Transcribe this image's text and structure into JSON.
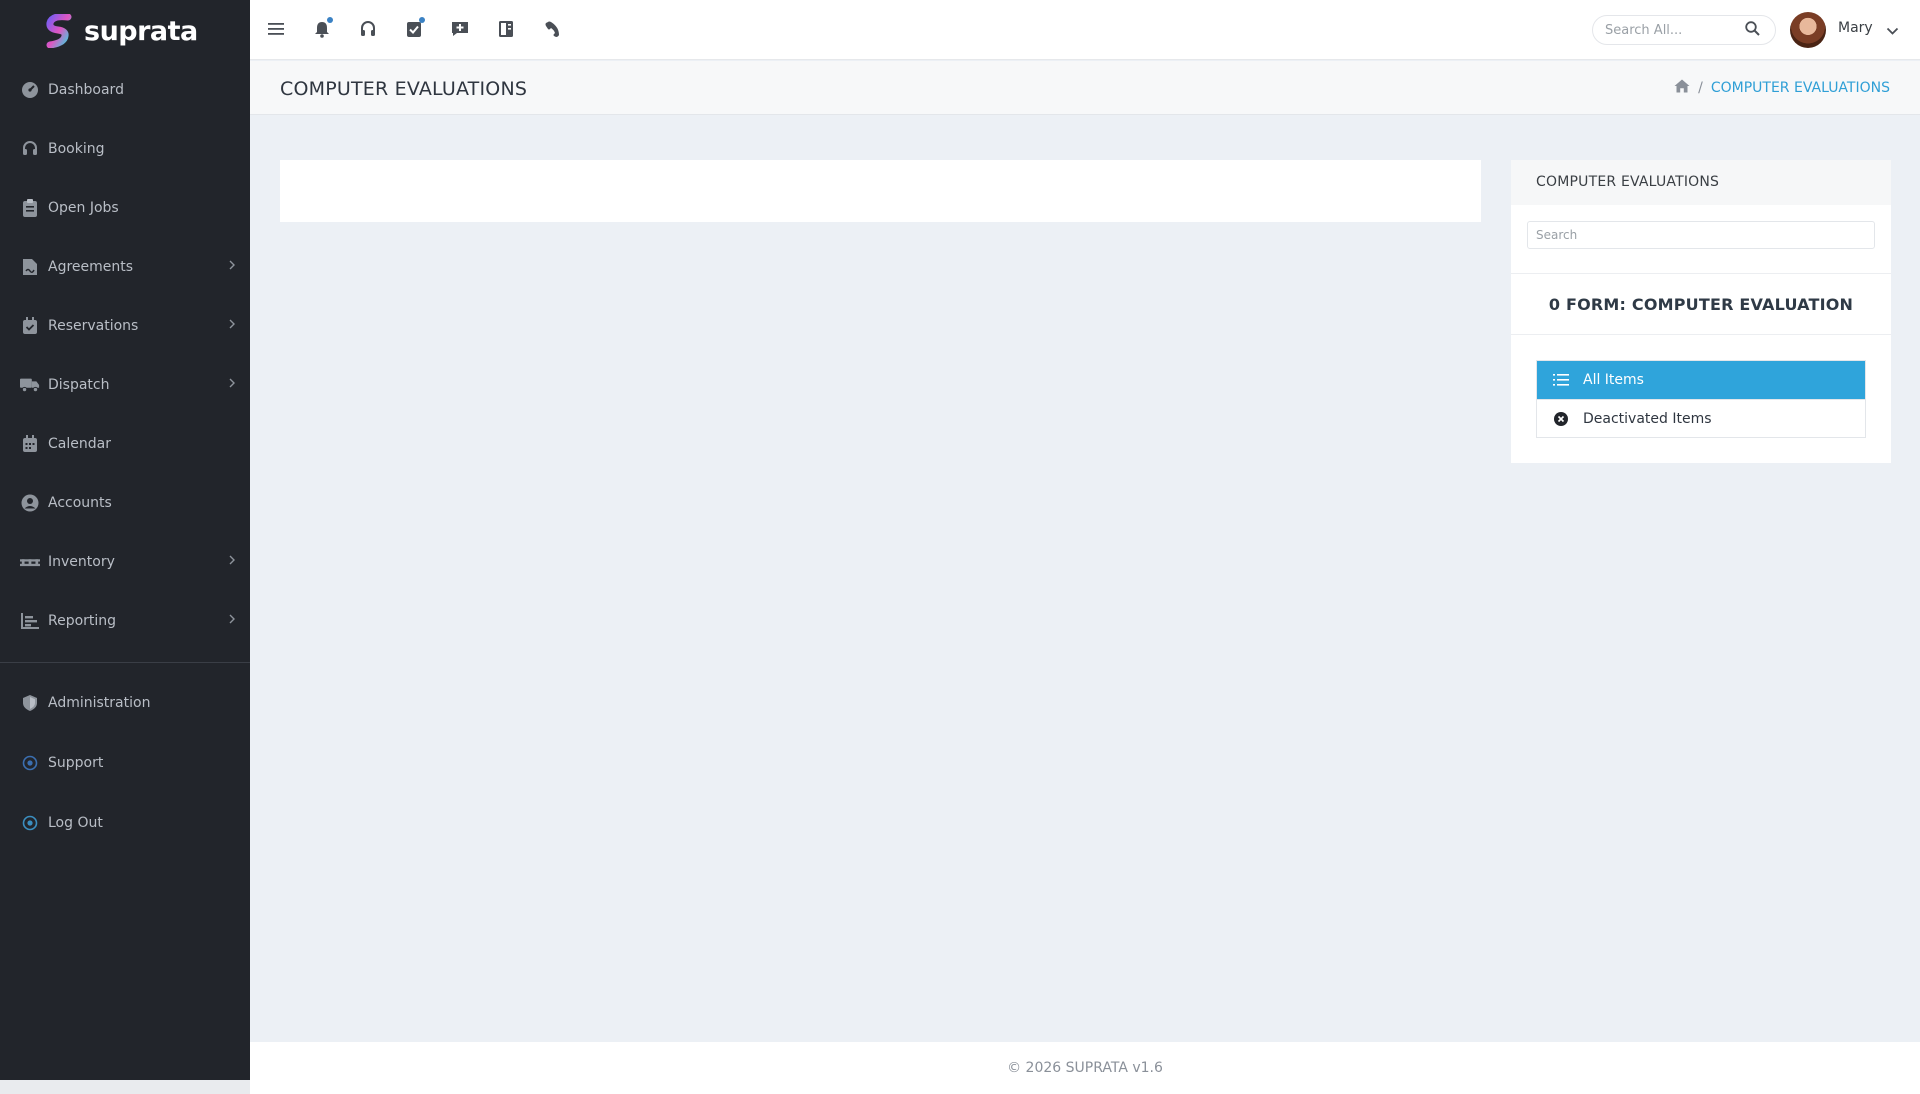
{
  "app": {
    "brand": "suprata"
  },
  "sidebar": {
    "items": [
      {
        "label": "Dashboard",
        "icon": "dashboard-gauge-icon",
        "has_submenu": false
      },
      {
        "label": "Booking",
        "icon": "headset-icon",
        "has_submenu": false
      },
      {
        "label": "Open Jobs",
        "icon": "clipboard-icon",
        "has_submenu": false
      },
      {
        "label": "Agreements",
        "icon": "file-signature-icon",
        "has_submenu": true
      },
      {
        "label": "Reservations",
        "icon": "calendar-check-icon",
        "has_submenu": true
      },
      {
        "label": "Dispatch",
        "icon": "truck-icon",
        "has_submenu": true
      },
      {
        "label": "Calendar",
        "icon": "calendar-icon",
        "has_submenu": false
      },
      {
        "label": "Accounts",
        "icon": "user-circle-icon",
        "has_submenu": false
      },
      {
        "label": "Inventory",
        "icon": "pallet-icon",
        "has_submenu": true
      },
      {
        "label": "Reporting",
        "icon": "bar-chart-icon",
        "has_submenu": true
      }
    ],
    "bottom_items": [
      {
        "label": "Administration",
        "icon": "shield-icon"
      },
      {
        "label": "Support",
        "icon": "dot-circle-icon"
      },
      {
        "label": "Log Out",
        "icon": "dot-circle-icon"
      }
    ]
  },
  "topbar": {
    "icons": [
      "menu-icon",
      "bell-icon",
      "headset-icon",
      "task-check-icon",
      "comment-plus-icon",
      "receipt-icon",
      "phone-icon"
    ],
    "search_placeholder": "Search All...",
    "user_name": "Mary"
  },
  "page": {
    "title": "COMPUTER EVALUATIONS",
    "breadcrumb_current": "COMPUTER EVALUATIONS"
  },
  "right_panel": {
    "heading": "COMPUTER EVALUATIONS",
    "search_placeholder": "Search",
    "count_label": "0 FORM: COMPUTER EVALUATION",
    "filters": [
      {
        "label": "All Items",
        "active": true
      },
      {
        "label": "Deactivated Items",
        "active": false
      }
    ]
  },
  "footer": {
    "text": "© 2026 SUPRATA v1.6"
  },
  "colors": {
    "sidebar_bg": "#22252b",
    "accent": "#2fa4db",
    "page_bg": "#ecf0f5",
    "notification_dot": "#3b82c4"
  }
}
